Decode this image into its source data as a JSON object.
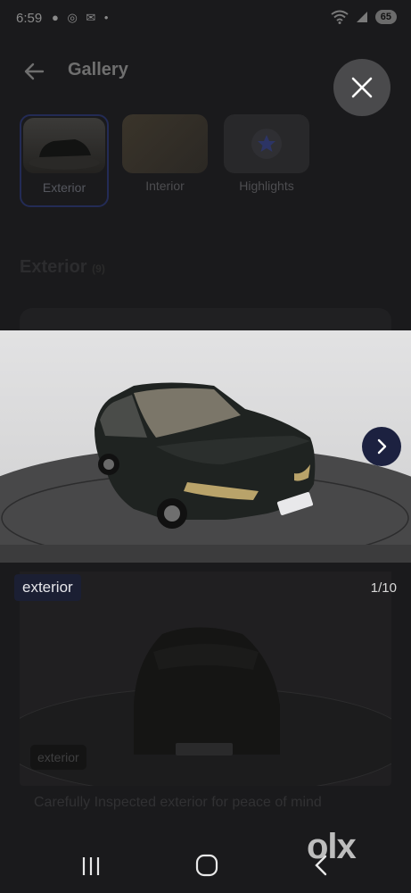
{
  "status_bar": {
    "time": "6:59",
    "notification_icons": "● ◎ ✉ •",
    "battery": "65",
    "wifi_icon": "wifi-icon"
  },
  "header": {
    "title": "Gallery"
  },
  "thumbnails": [
    {
      "label": "Exterior",
      "selected": true
    },
    {
      "label": "Interior",
      "selected": false
    },
    {
      "label": "Highlights",
      "selected": false
    }
  ],
  "section": {
    "title": "Exterior",
    "count": "(9)"
  },
  "viewer": {
    "caption": "exterior",
    "counter": "1/10"
  },
  "background_card": {
    "tag": "exterior",
    "description": "Carefully Inspected exterior for peace of mind"
  },
  "watermark": "olx",
  "colors": {
    "overlay": "#1a1a1c",
    "accent": "#1c2140",
    "car_body": "#1f2321"
  }
}
